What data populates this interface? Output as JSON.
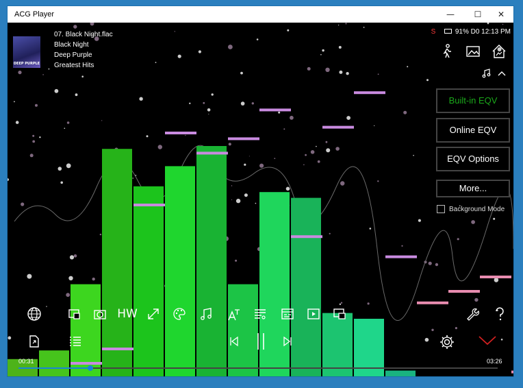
{
  "window": {
    "title": "ACG Player"
  },
  "track": {
    "filename": "07. Black Night.flac",
    "title": "Black Night",
    "artist": "Deep Purple",
    "album": "Greatest Hits",
    "album_art_text": "DEEP PURPLE"
  },
  "status": {
    "indicator": "S",
    "info": "91% D0 12:13 PM"
  },
  "eqv": {
    "builtin_label": "Built-in EQV",
    "online_label": "Online EQV",
    "options_label": "EQV Options",
    "more_label": "More...",
    "background_mode_label": "Background Mode",
    "background_mode_checked": false
  },
  "toolbar": {
    "hw_label": "HW"
  },
  "playback": {
    "elapsed": "00:31",
    "duration": "03:26",
    "progress_fraction": 0.15
  },
  "spectrum": {
    "bar_levels": [
      0.06,
      0.09,
      0.32,
      0.79,
      0.66,
      0.73,
      0.8,
      0.32,
      0.64,
      0.62,
      0.22,
      0.2,
      0.02
    ],
    "peak_levels": [
      0.05,
      0.1,
      0.6,
      0.85,
      0.78,
      0.83,
      0.93,
      0.49,
      0.87,
      0.99,
      0.42,
      0.26,
      0.3,
      0.35,
      0.02
    ]
  },
  "colors": {
    "accent": "#1a84d8",
    "builtin_active": "#1aa81a",
    "peak": "#c98be0",
    "status_s": "#ff3b3b",
    "close_chevron": "#d02020"
  }
}
